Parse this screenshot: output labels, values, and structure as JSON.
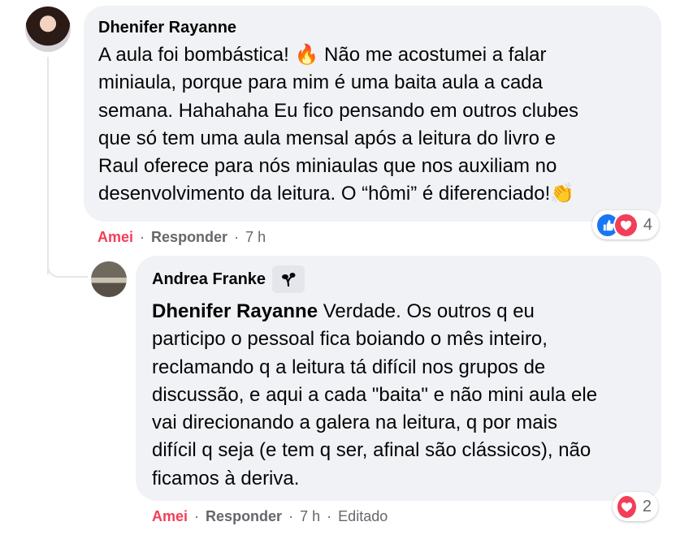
{
  "comment1": {
    "author": "Dhenifer Rayanne",
    "lines": [
      "A aula foi bombástica! 🔥 Não me acostumei a falar",
      "miniaula, porque para mim é uma baita aula a cada",
      "semana. Hahahaha Eu fico pensando em outros clubes",
      "que só tem uma aula mensal após a leitura do livro e",
      "Raul oferece para nós miniaulas que nos auxiliam no",
      "desenvolvimento da leitura. O “hômi” é diferenciado!👏"
    ],
    "reaction_count": "4",
    "action_love": "Amei",
    "action_reply": "Responder",
    "time": "7 h",
    "separator": "·"
  },
  "comment2": {
    "author": "Andrea Franke",
    "mention": "Dhenifer Rayanne",
    "first_line_rest": " Verdade. Os outros q eu",
    "lines": [
      "participo o pessoal fica boiando o mês inteiro,",
      "reclamando q a leitura tá difícil nos grupos de",
      "discussão, e aqui a cada \"baita\" e não mini aula ele",
      "vai direcionando a galera na leitura, q por mais",
      "difícil q seja (e tem q ser, afinal são clássicos), não",
      "ficamos à deriva."
    ],
    "reaction_count": "2",
    "action_love": "Amei",
    "action_reply": "Responder",
    "time": "7 h",
    "edited": "Editado",
    "separator": "·"
  },
  "icons": {
    "badge": "rising-fan-badge-icon",
    "like": "like-reaction-icon",
    "love": "love-reaction-icon"
  },
  "colors": {
    "bubble": "#f0f2f5",
    "love": "#f33e58",
    "like": "#1877f2",
    "meta": "#65676b"
  }
}
